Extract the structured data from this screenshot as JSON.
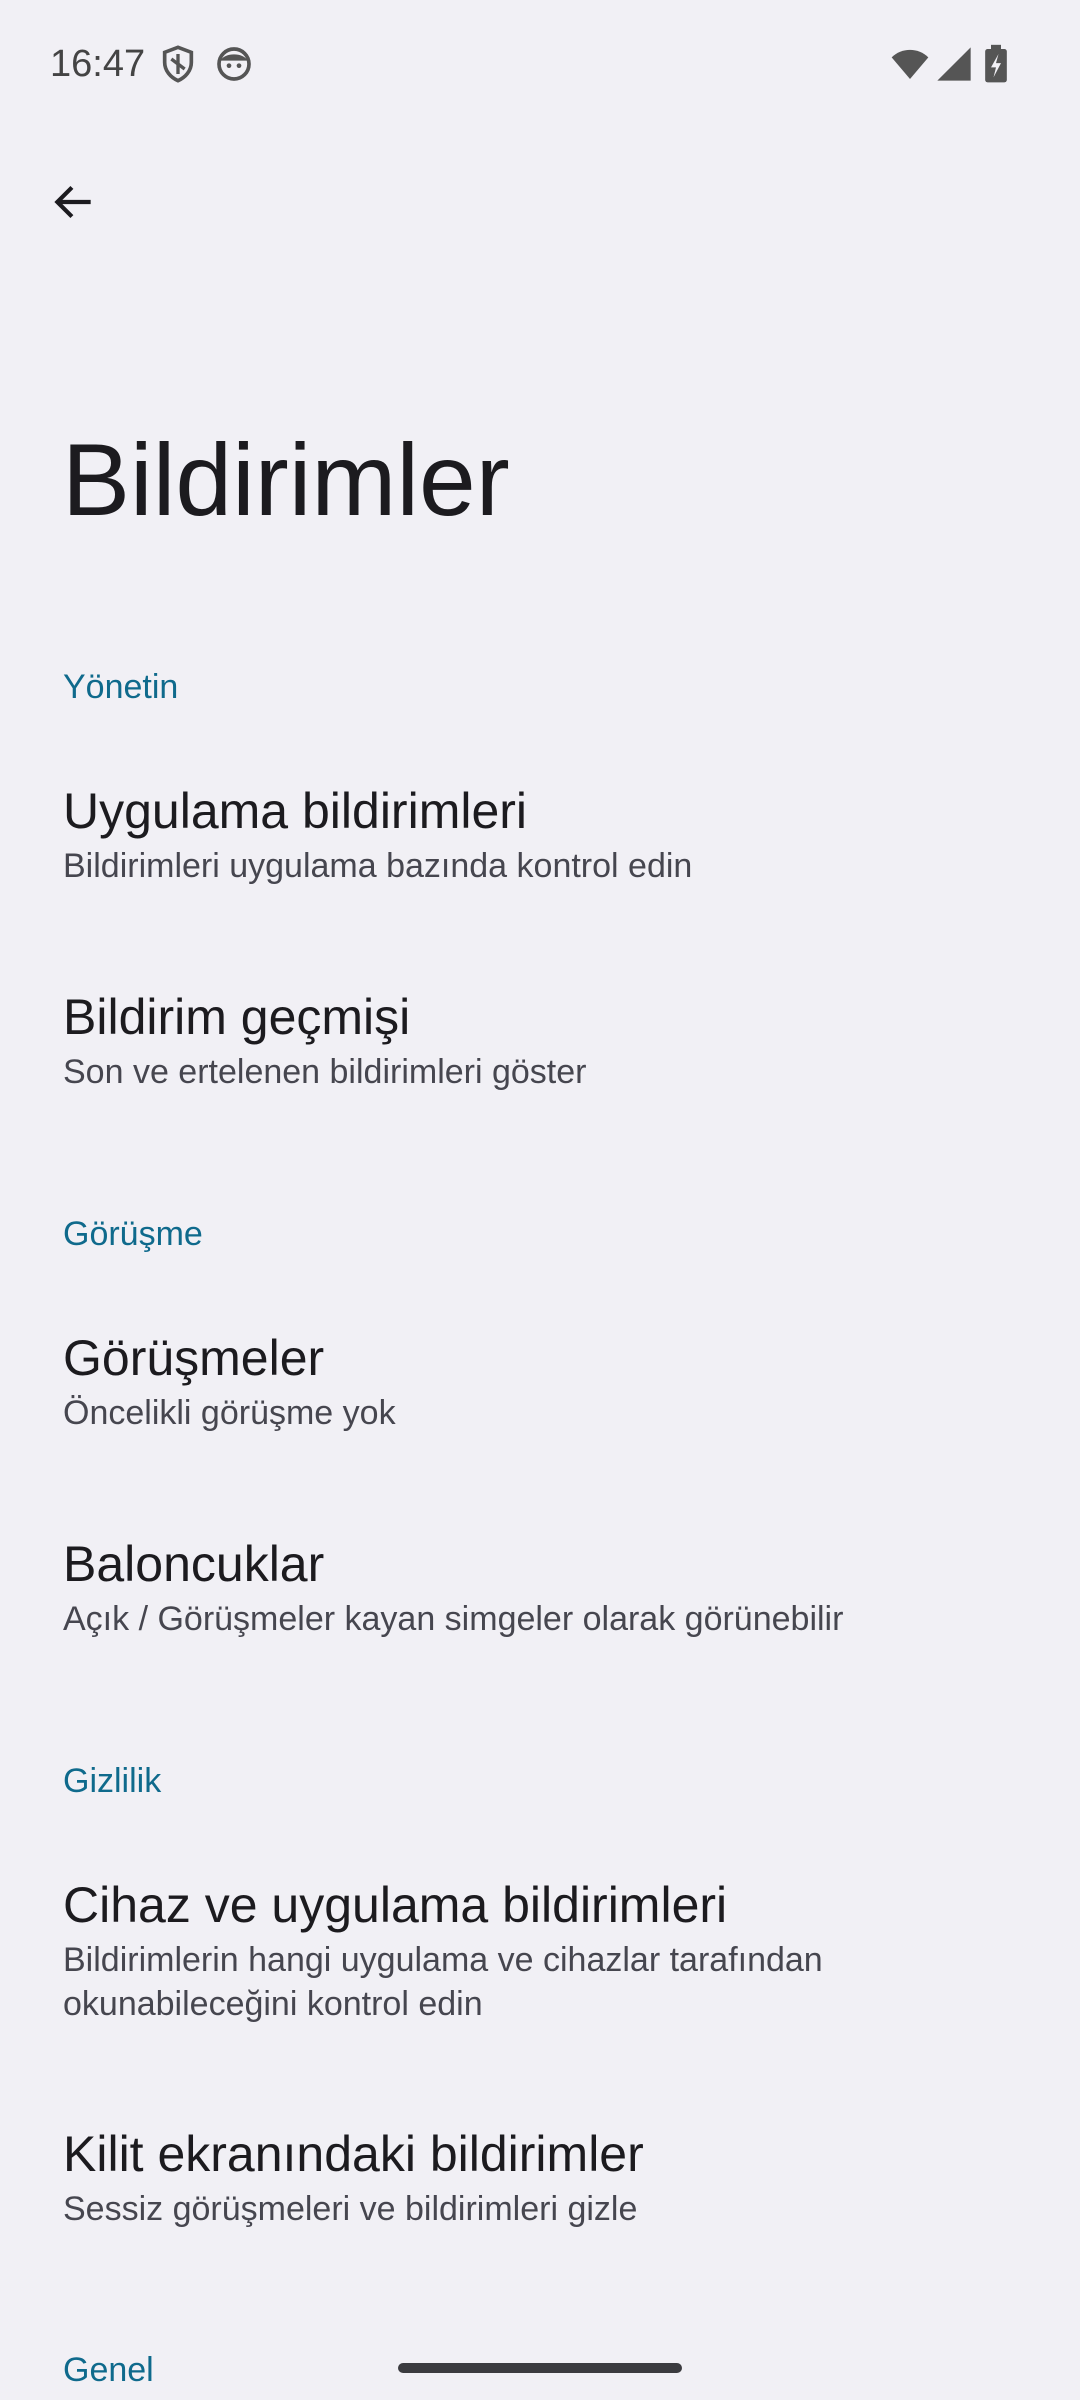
{
  "status_bar": {
    "time": "16:47",
    "left_icons": [
      "shield-icon",
      "face-icon"
    ],
    "right_icons": [
      "wifi-icon",
      "signal-icon",
      "battery-charging-icon"
    ]
  },
  "header": {
    "back_icon": "arrow-left-icon",
    "title": "Bildirimler"
  },
  "sections": {
    "manage": {
      "header": "Yönetin",
      "items": [
        {
          "title": "Uygulama bildirimleri",
          "subtitle": "Bildirimleri uygulama bazında kontrol edin"
        },
        {
          "title": "Bildirim geçmişi",
          "subtitle": "Son ve ertelenen bildirimleri göster"
        }
      ]
    },
    "conversation": {
      "header": "Görüşme",
      "items": [
        {
          "title": "Görüşmeler",
          "subtitle": "Öncelikli görüşme yok"
        },
        {
          "title": "Baloncuklar",
          "subtitle": "Açık / Görüşmeler kayan simgeler olarak görünebilir"
        }
      ]
    },
    "privacy": {
      "header": "Gizlilik",
      "items": [
        {
          "title": "Cihaz ve uygulama bildirimleri",
          "subtitle": "Bildirimlerin hangi uygulama ve cihazlar tarafından okunabileceğini kontrol edin"
        },
        {
          "title": "Kilit ekranındaki bildirimler",
          "subtitle": "Sessiz görüşmeleri ve bildirimleri gizle"
        }
      ]
    },
    "general": {
      "header": "Genel"
    }
  },
  "colors": {
    "background": "#f1f0f5",
    "accent": "#0f6a8c",
    "text_primary": "#1c1b1f",
    "text_secondary": "#46464f"
  }
}
